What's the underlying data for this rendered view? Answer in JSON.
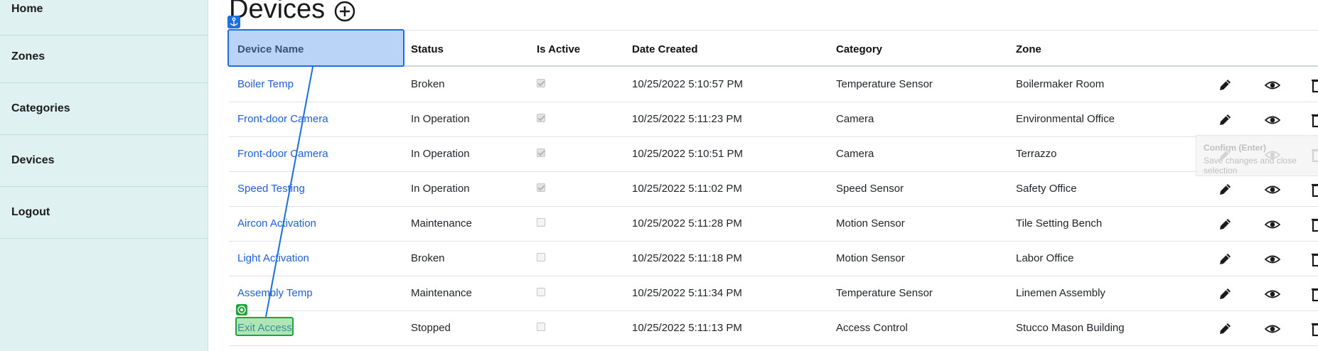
{
  "sidebar": {
    "items": [
      {
        "label": "Home"
      },
      {
        "label": "Zones"
      },
      {
        "label": "Categories"
      },
      {
        "label": "Devices"
      },
      {
        "label": "Logout"
      }
    ]
  },
  "page": {
    "title": "Devices",
    "add_icon": "plus-circle-icon"
  },
  "table": {
    "columns": [
      "Device Name",
      "Status",
      "Is Active",
      "Date Created",
      "Category",
      "Zone"
    ],
    "rows": [
      {
        "name": "Boiler Temp",
        "status": "Broken",
        "active": true,
        "created": "10/25/2022 5:10:57 PM",
        "category": "Temperature Sensor",
        "zone": "Boilermaker Room"
      },
      {
        "name": "Front-door Camera",
        "status": "In Operation",
        "active": true,
        "created": "10/25/2022 5:11:23 PM",
        "category": "Camera",
        "zone": "Environmental Office"
      },
      {
        "name": "Front-door Camera",
        "status": "In Operation",
        "active": true,
        "created": "10/25/2022 5:10:51 PM",
        "category": "Camera",
        "zone": "Terrazzo"
      },
      {
        "name": "Speed Testing",
        "status": "In Operation",
        "active": true,
        "created": "10/25/2022 5:11:02 PM",
        "category": "Speed Sensor",
        "zone": "Safety Office"
      },
      {
        "name": "Aircon Activation",
        "status": "Maintenance",
        "active": false,
        "created": "10/25/2022 5:11:28 PM",
        "category": "Motion Sensor",
        "zone": "Tile Setting Bench"
      },
      {
        "name": "Light Activation",
        "status": "Broken",
        "active": false,
        "created": "10/25/2022 5:11:18 PM",
        "category": "Motion Sensor",
        "zone": "Labor Office"
      },
      {
        "name": "Assembly Temp",
        "status": "Maintenance",
        "active": false,
        "created": "10/25/2022 5:11:34 PM",
        "category": "Temperature Sensor",
        "zone": "Linemen Assembly"
      },
      {
        "name": "Exit Access",
        "status": "Stopped",
        "active": false,
        "created": "10/25/2022 5:11:13 PM",
        "category": "Access Control",
        "zone": "Stucco Mason Building"
      }
    ],
    "row_actions": [
      "pencil-icon",
      "eye-icon",
      "trash-icon"
    ]
  },
  "overlay": {
    "tooltip_title": "Confirm (Enter)",
    "tooltip_text": "Save changes and close selection",
    "anchor_icon": "anchor-icon",
    "target_icon": "target-icon"
  },
  "colors": {
    "sidebar_bg": "#dff2f1",
    "link": "#1f5fd6",
    "selection": "#1c6fe0",
    "target": "#22a33b"
  }
}
